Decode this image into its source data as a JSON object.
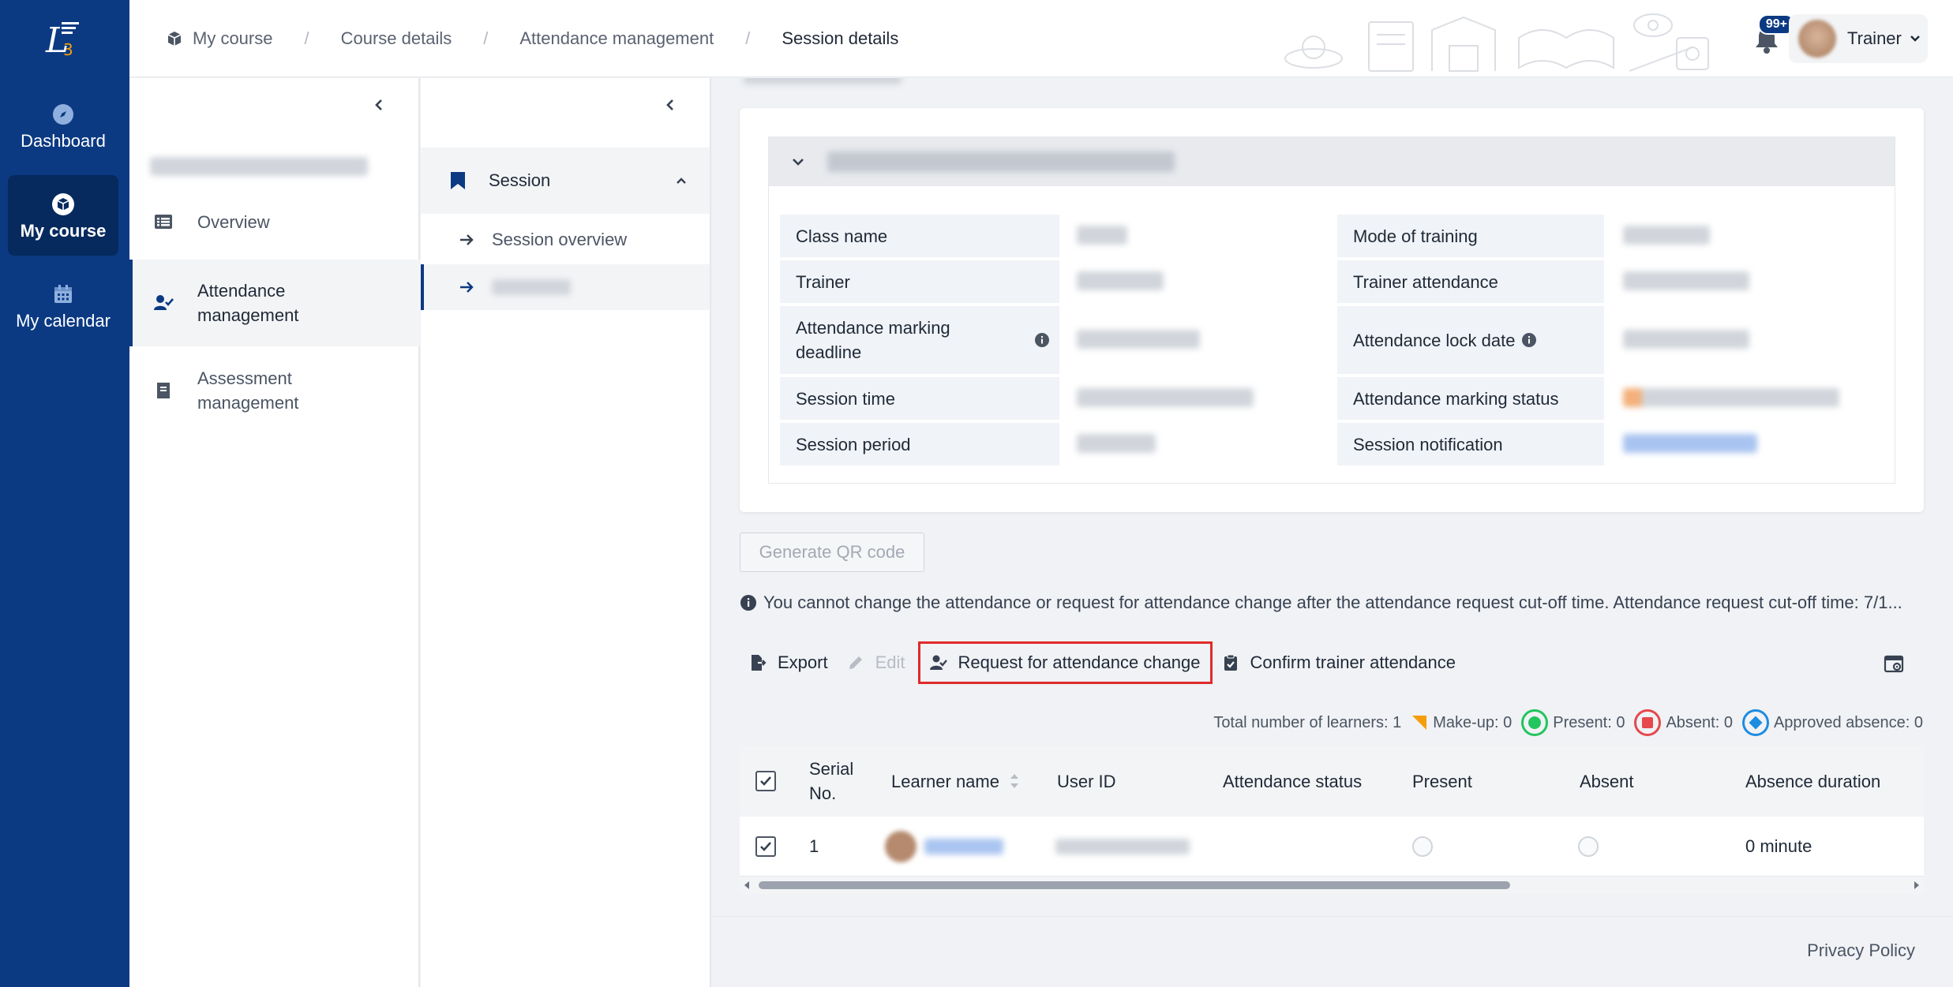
{
  "nav": {
    "logo_icon": "l3-logo-icon",
    "items": [
      {
        "label": "Dashboard",
        "icon": "compass-icon"
      },
      {
        "label": "My course",
        "icon": "cube-icon",
        "active": true
      },
      {
        "label": "My calendar",
        "icon": "calendar-icon"
      }
    ]
  },
  "header": {
    "breadcrumb": [
      "My course",
      "Course details",
      "Attendance management",
      "Session details"
    ],
    "notification_count": "99+",
    "user_name": "Trainer"
  },
  "course_panel": {
    "items": [
      {
        "label": "Overview",
        "icon": "list-icon"
      },
      {
        "label": "Attendance management",
        "icon": "user-check-icon",
        "active": true
      },
      {
        "label": "Assessment management",
        "icon": "book-icon"
      }
    ]
  },
  "session_panel": {
    "header": "Session",
    "items": [
      {
        "label": "Session overview",
        "icon": "arrow-right-icon"
      },
      {
        "label": "",
        "icon": "arrow-right-icon",
        "active": true
      }
    ]
  },
  "session_info": {
    "left_labels": [
      "Class name",
      "Trainer",
      "Attendance marking deadline",
      "Session time",
      "Session period"
    ],
    "right_labels": [
      "Mode of training",
      "Trainer attendance",
      "Attendance lock date",
      "Attendance marking status",
      "Session notification"
    ]
  },
  "qr_button": "Generate QR code",
  "notice": "You cannot change the attendance or request for attendance change after the attendance request cut-off time. Attendance request cut-off time: 7/1...",
  "toolbar": {
    "export": "Export",
    "edit": "Edit",
    "request_change": "Request for attendance change",
    "confirm_trainer": "Confirm trainer attendance"
  },
  "summary": {
    "total": "Total number of learners: 1",
    "makeup": "Make-up: 0",
    "present": "Present: 0",
    "absent": "Absent: 0",
    "approved_absence": "Approved absence: 0"
  },
  "colors": {
    "nav_bg": "#0b3a82",
    "makeup": "#f59e0b",
    "present": "#22c55e",
    "absent": "#e5484d",
    "approved": "#1d8ce0",
    "highlight": "#e02b2b"
  },
  "table": {
    "columns": [
      "Serial No.",
      "Learner name",
      "User ID",
      "Attendance status",
      "Present",
      "Absent",
      "Absence duration"
    ],
    "rows": [
      {
        "serial": "1",
        "absence_duration": "0 minute"
      }
    ]
  },
  "footer": {
    "privacy": "Privacy Policy"
  }
}
